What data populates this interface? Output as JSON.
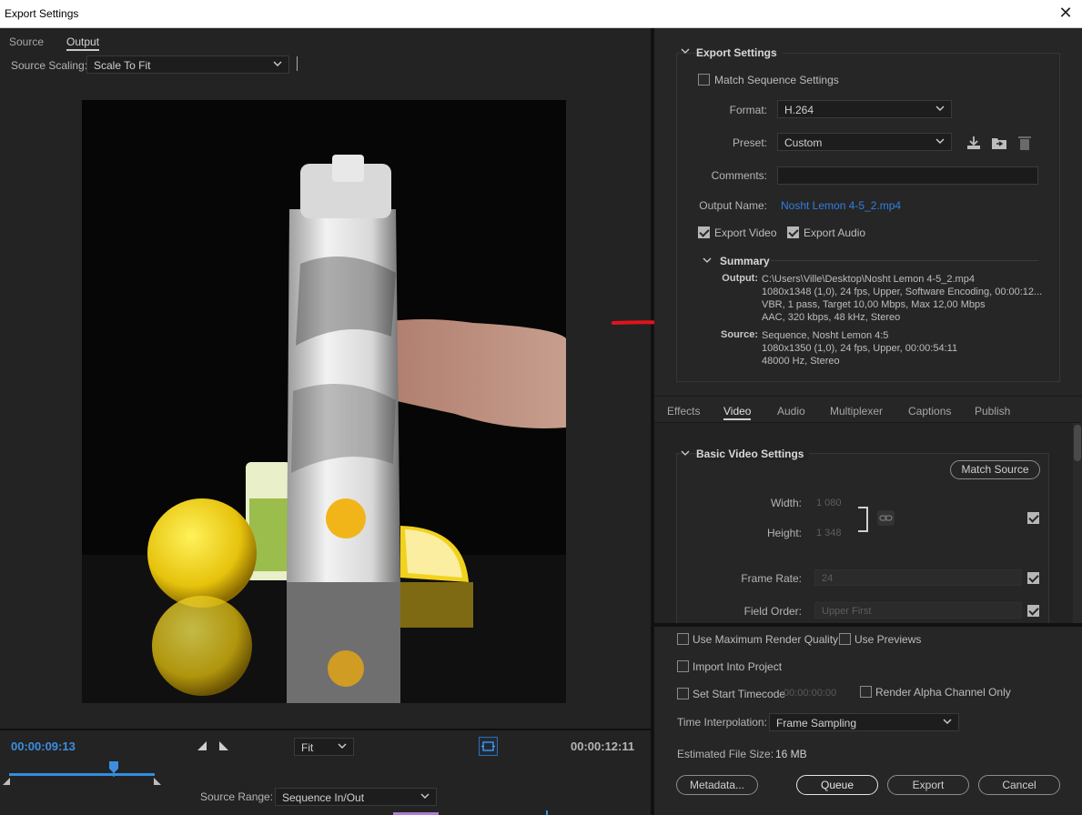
{
  "window": {
    "title": "Export Settings",
    "close_glyph": "✕"
  },
  "left": {
    "tabs": [
      {
        "label": "Source"
      },
      {
        "label": "Output"
      }
    ],
    "source_scaling": {
      "label": "Source Scaling:",
      "value": "Scale To Fit"
    },
    "timecode_current": "00:00:09:13",
    "timecode_duration": "00:00:12:11",
    "zoom": "Fit",
    "playhead_progress": 0.72,
    "source_range": {
      "label": "Source Range:",
      "value": "Sequence In/Out"
    }
  },
  "export_settings": {
    "section_title": "Export Settings",
    "match_sequence": {
      "label": "Match Sequence Settings",
      "checked": false
    },
    "format": {
      "label": "Format:",
      "value": "H.264"
    },
    "preset": {
      "label": "Preset:",
      "value": "Custom"
    },
    "comments": {
      "label": "Comments:",
      "value": ""
    },
    "output_name": {
      "label": "Output Name:",
      "value": "Nosht Lemon 4-5_2.mp4"
    },
    "export_video": {
      "label": "Export Video",
      "checked": true
    },
    "export_audio": {
      "label": "Export Audio",
      "checked": true
    },
    "summary": {
      "title": "Summary",
      "output_label": "Output:",
      "output_lines": [
        "C:\\Users\\Ville\\Desktop\\Nosht Lemon 4-5_2.mp4",
        "1080x1348 (1,0), 24 fps, Upper, Software Encoding, 00:00:12...",
        "VBR, 1 pass, Target 10,00 Mbps, Max 12,00 Mbps",
        "AAC, 320 kbps, 48 kHz, Stereo"
      ],
      "source_label": "Source:",
      "source_lines": [
        "Sequence, Nosht Lemon 4:5",
        "1080x1350 (1,0), 24 fps, Upper, 00:00:54:11",
        "48000 Hz, Stereo"
      ]
    }
  },
  "tabs2": [
    {
      "label": "Effects"
    },
    {
      "label": "Video"
    },
    {
      "label": "Audio"
    },
    {
      "label": "Multiplexer"
    },
    {
      "label": "Captions"
    },
    {
      "label": "Publish"
    }
  ],
  "video_settings": {
    "section_title": "Basic Video Settings",
    "match_source": "Match Source",
    "width": {
      "label": "Width:",
      "value": "1 080"
    },
    "height": {
      "label": "Height:",
      "value": "1 348"
    },
    "frame_rate": {
      "label": "Frame Rate:",
      "value": "24"
    },
    "field_order": {
      "label": "Field Order:",
      "value": "Upper First"
    }
  },
  "bottom": {
    "max_render_quality": "Use Maximum Render Quality",
    "use_previews": "Use Previews",
    "import_into_project": "Import Into Project",
    "set_start_timecode": "Set Start Timecode",
    "start_timecode_value": "00:00:00:00",
    "render_alpha": "Render Alpha Channel Only",
    "time_interpolation": {
      "label": "Time Interpolation:",
      "value": "Frame Sampling"
    },
    "estimated_size": {
      "label": "Estimated File Size:",
      "value": "16 MB"
    },
    "buttons": {
      "metadata": "Metadata...",
      "queue": "Queue",
      "export": "Export",
      "cancel": "Cancel"
    }
  },
  "colors": {
    "accent_blue": "#3d8ee0",
    "link_blue": "#2f7fe0",
    "annotation_red": "#e0141a"
  }
}
